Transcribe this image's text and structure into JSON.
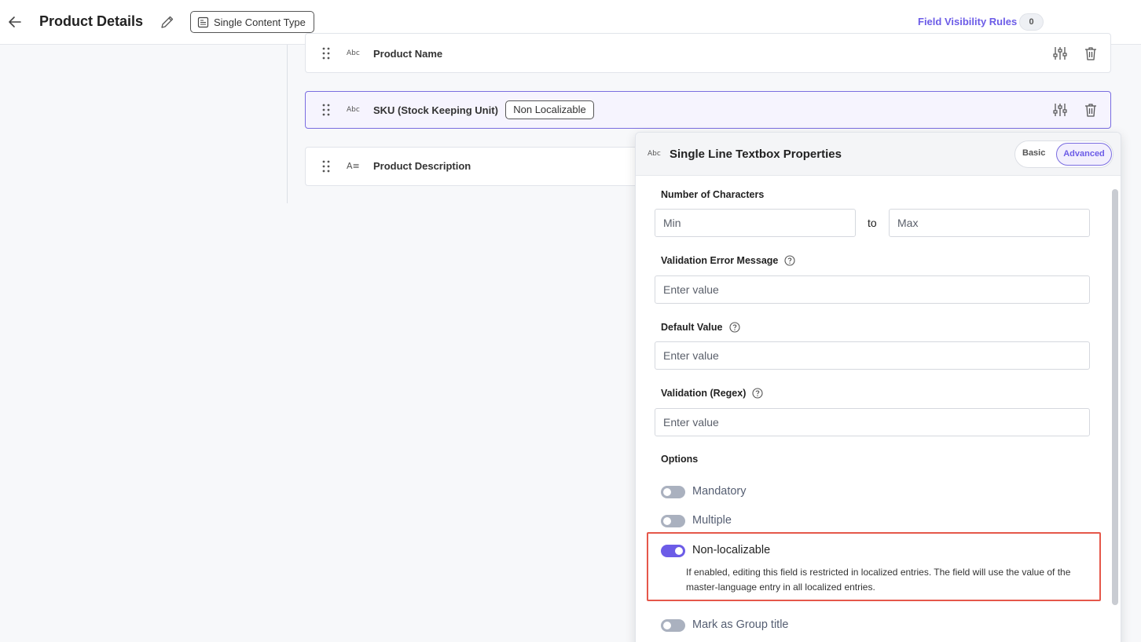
{
  "header": {
    "title": "Product Details",
    "content_type_chip": "Single Content Type",
    "field_visibility_label": "Field Visibility Rules",
    "field_visibility_count": "0"
  },
  "fields": [
    {
      "type_icon": "Abc",
      "label": "Product Name"
    },
    {
      "type_icon": "Abc",
      "label": "SKU (Stock Keeping Unit)",
      "badge": "Non Localizable"
    },
    {
      "type_icon": "A≡",
      "label": "Product Description"
    }
  ],
  "props": {
    "icon_text": "Abc",
    "title": "Single Line Textbox Properties",
    "tabs": {
      "basic": "Basic",
      "advanced": "Advanced",
      "active": "Advanced"
    },
    "num_chars": {
      "label": "Number of Characters",
      "min_placeholder": "Min",
      "to": "to",
      "max_placeholder": "Max"
    },
    "validation_error": {
      "label": "Validation Error Message",
      "placeholder": "Enter value"
    },
    "default_value": {
      "label": "Default Value",
      "placeholder": "Enter value"
    },
    "regex": {
      "label": "Validation (Regex)",
      "placeholder": "Enter value"
    },
    "options_label": "Options",
    "options": [
      {
        "label": "Mandatory",
        "enabled": false
      },
      {
        "label": "Multiple",
        "enabled": false
      },
      {
        "label": "Non-localizable",
        "enabled": true
      },
      {
        "label": "Mark as Group title",
        "enabled": false
      }
    ],
    "non_localizable_desc": "If enabled, editing this field is restricted in localized entries. The field will use the value of the master-language entry in all localized entries."
  },
  "colors": {
    "accent": "#6c5ce7",
    "highlight": "#e5574a",
    "toggle_off": "#aab1bf"
  }
}
